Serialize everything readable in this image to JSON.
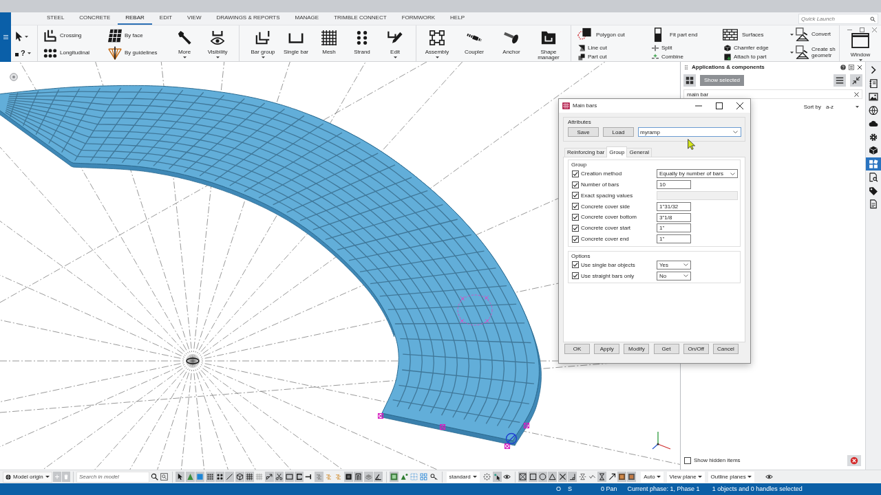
{
  "ribbon": {
    "tabs": [
      {
        "label": "STEEL",
        "selected": false
      },
      {
        "label": "CONCRETE",
        "selected": false
      },
      {
        "label": "REBAR",
        "selected": true
      },
      {
        "label": "EDIT",
        "selected": false
      },
      {
        "label": "VIEW",
        "selected": false
      },
      {
        "label": "DRAWINGS & REPORTS",
        "selected": false
      },
      {
        "label": "MANAGE",
        "selected": false
      },
      {
        "label": "TRIMBLE CONNECT",
        "selected": false
      },
      {
        "label": "FORMWORK",
        "selected": false
      },
      {
        "label": "HELP",
        "selected": false
      }
    ],
    "quick_launch": {
      "placeholder": "Quick Launch"
    },
    "sections": [
      {
        "columns": [
          {
            "items": [
              {
                "kind": "tool",
                "dropdown": true
              },
              {
                "kind": "tool",
                "glyph": "?",
                "dropdown": true
              }
            ]
          }
        ]
      },
      {
        "columns": [
          {
            "items": [
              {
                "kind": "small",
                "label": "Crossing",
                "dropdown": false
              },
              {
                "kind": "small",
                "label": "Longitudinal",
                "dropdown": false
              }
            ]
          },
          {
            "items": [
              {
                "kind": "small",
                "label": "By face",
                "dropdown": false
              },
              {
                "kind": "small",
                "label": "By guidelines",
                "dropdown": false
              }
            ]
          },
          {
            "items": [
              {
                "kind": "large",
                "label": "More",
                "dropdown": true
              }
            ]
          },
          {
            "items": [
              {
                "kind": "large",
                "label": "Visibility",
                "dropdown": true
              }
            ]
          }
        ]
      },
      {
        "columns": [
          {
            "items": [
              {
                "kind": "large",
                "label": "Bar group",
                "dropdown": true
              }
            ]
          },
          {
            "items": [
              {
                "kind": "large",
                "label": "Single bar",
                "dropdown": false
              }
            ]
          },
          {
            "items": [
              {
                "kind": "large",
                "label": "Mesh",
                "dropdown": false
              }
            ]
          },
          {
            "items": [
              {
                "kind": "large",
                "label": "Strand",
                "dropdown": false
              }
            ]
          },
          {
            "items": [
              {
                "kind": "large",
                "label": "Edit",
                "dropdown": true
              }
            ]
          }
        ]
      },
      {
        "columns": [
          {
            "items": [
              {
                "kind": "large",
                "label": "Assembly",
                "dropdown": true
              }
            ]
          },
          {
            "items": [
              {
                "kind": "large",
                "label": "Coupler",
                "dropdown": false
              }
            ]
          },
          {
            "items": [
              {
                "kind": "large",
                "label": "Anchor",
                "dropdown": false
              }
            ]
          },
          {
            "items": [
              {
                "kind": "large",
                "label": "Shape manager",
                "dropdown": false
              }
            ]
          }
        ]
      },
      {
        "columns": [
          {
            "items": [
              {
                "kind": "medium",
                "label": "Polygon cut",
                "dropdown": false
              },
              {
                "kind": "small",
                "label": "Line cut",
                "dropdown": false
              },
              {
                "kind": "small",
                "label": "Part cut",
                "dropdown": false
              }
            ]
          },
          {
            "items": [
              {
                "kind": "medium",
                "label": "Fit part end",
                "dropdown": false
              },
              {
                "kind": "small",
                "label": "Split",
                "dropdown": false
              },
              {
                "kind": "small",
                "label": "Combine",
                "dropdown": false
              }
            ]
          },
          {
            "items": [
              {
                "kind": "medium",
                "label": "Surfaces",
                "dropdown": false
              },
              {
                "kind": "small",
                "label": "Chamfer edge",
                "dropdown": false
              },
              {
                "kind": "small",
                "label": "Attach to part",
                "dropdown": false
              }
            ]
          }
        ]
      },
      {
        "columns": [
          {
            "items": [
              {
                "kind": "split",
                "label": "Convert",
                "dropdown": true
              },
              {
                "kind": "split",
                "label": "Create sh\ngeometr",
                "dropdown": true
              }
            ]
          }
        ]
      },
      {
        "columns": [
          {
            "items": [
              {
                "kind": "large",
                "label": "Window",
                "dropdown": true
              }
            ]
          }
        ]
      }
    ]
  },
  "dialog": {
    "title": "Main bars",
    "attributes": {
      "legend": "Attributes",
      "buttons": [
        "Save",
        "Load"
      ],
      "value": "myramp"
    },
    "tabs": [
      {
        "label": "Reinforcing bar",
        "selected": false
      },
      {
        "label": "Group",
        "selected": true
      },
      {
        "label": "General",
        "selected": false
      }
    ],
    "fieldsets": [
      {
        "legend": "Group",
        "rows": [
          {
            "label": "Creation method",
            "checked": true,
            "kind": "select",
            "value": "Equally by number of bars",
            "disabled": false
          },
          {
            "label": "Number of bars",
            "checked": true,
            "kind": "input",
            "value": "10",
            "disabled": false
          },
          {
            "label": "Exact spacing values",
            "checked": true,
            "kind": "wide",
            "disabled": true
          },
          {
            "label": "Concrete cover side",
            "checked": true,
            "kind": "input",
            "value": "1\"31/32",
            "disabled": false
          },
          {
            "label": "Concrete cover bottom",
            "checked": true,
            "kind": "input",
            "value": "3\"1/8",
            "disabled": false
          },
          {
            "label": "Concrete cover start",
            "checked": true,
            "kind": "input",
            "value": "1\"",
            "disabled": false
          },
          {
            "label": "Concrete cover end",
            "checked": true,
            "kind": "input",
            "value": "1\"",
            "disabled": false
          }
        ]
      },
      {
        "legend": "Options",
        "rows": [
          {
            "label": "Use single bar objects",
            "checked": true,
            "kind": "toggle",
            "value": "Yes",
            "disabled": false
          },
          {
            "label": "Use straight bars only",
            "checked": true,
            "kind": "toggle",
            "value": "No",
            "disabled": false
          }
        ]
      }
    ],
    "buttons": [
      "OK",
      "Apply",
      "Modify",
      "Get",
      "On/Off",
      "Cancel"
    ]
  },
  "side_panel": {
    "title": "Applications & components",
    "show_selected": {
      "label": "Show selected",
      "disabled": true
    },
    "search": {
      "value": "main bar"
    },
    "sort": {
      "label": "Sort by",
      "value": "a-z"
    },
    "show_hidden": {
      "label": "Show hidden items",
      "checked": false
    }
  },
  "side_toolbar": {
    "items": [
      {
        "selected": false
      },
      {
        "selected": false
      },
      {
        "selected": false
      },
      {
        "selected": false
      },
      {
        "selected": false
      },
      {
        "selected": false
      },
      {
        "selected": false
      },
      {
        "selected": true
      },
      {
        "selected": false
      },
      {
        "selected": false
      },
      {
        "selected": false
      }
    ]
  },
  "bottom_toolbar": {
    "origin": "Model origin",
    "origin_tools": [
      {
        "disabled": true
      },
      {
        "disabled": true
      }
    ],
    "search": {
      "placeholder": "Search in model"
    },
    "tool_groups": [
      {
        "tools": [
          {
            "pressed": true
          },
          {
            "pressed": true
          },
          {
            "pressed": true
          },
          {
            "pressed": true
          },
          {
            "pressed": true
          },
          {
            "pressed": true
          },
          {
            "pressed": true
          },
          {
            "pressed": true
          },
          {
            "pressed": false
          },
          {
            "pressed": true
          },
          {
            "pressed": true
          },
          {
            "pressed": true
          },
          {
            "pressed": true
          },
          {
            "pressed": false
          },
          {
            "pressed": true
          },
          {
            "pressed": false
          },
          {
            "pressed": false
          },
          {
            "pressed": true
          },
          {
            "pressed": true
          },
          {
            "pressed": true
          },
          {
            "pressed": true
          }
        ]
      },
      {
        "tools": [
          {
            "pressed": true
          },
          {
            "pressed": false
          },
          {
            "pressed": false
          },
          {
            "pressed": false
          },
          {
            "pressed": false
          }
        ]
      }
    ],
    "view": "standard",
    "view_tools": [
      {
        "pressed": false
      },
      {
        "pressed": true
      },
      {
        "pressed": false
      }
    ],
    "filter_tools": [
      {
        "pressed": true
      },
      {
        "pressed": true
      },
      {
        "pressed": true
      },
      {
        "pressed": true
      },
      {
        "pressed": true
      },
      {
        "pressed": true
      },
      {
        "pressed": false
      },
      {
        "pressed": false
      },
      {
        "pressed": true
      },
      {
        "pressed": false
      },
      {
        "pressed": true
      },
      {
        "pressed": true
      }
    ],
    "dropdowns": [
      "Auto",
      "View plane",
      "Outline planes"
    ]
  },
  "status_bar": {
    "items": [
      "O",
      "S",
      "0 Pan",
      "Current phase: 1, Phase 1",
      "1 objects and 0 handles selected"
    ]
  }
}
